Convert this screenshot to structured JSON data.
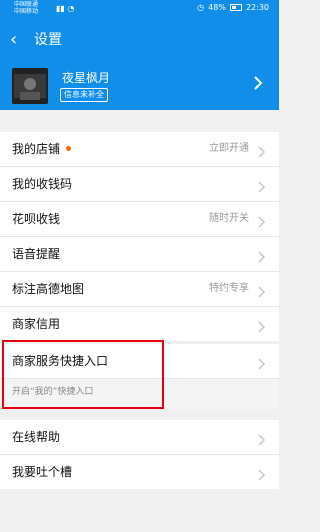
{
  "status_bar": {
    "carrier_1": "中国联通",
    "carrier_2": "中国移动",
    "battery": "48%",
    "time": "22:30"
  },
  "nav": {
    "title": "设置"
  },
  "profile": {
    "name": "夜星枫月",
    "badge": "信息未补全"
  },
  "groups": [
    {
      "items": [
        {
          "label": "我的店铺",
          "value": "立即开通",
          "has_dot": true
        },
        {
          "label": "我的收钱码",
          "value": ""
        },
        {
          "label": "花呗收钱",
          "value": "随时开关"
        },
        {
          "label": "语音提醒",
          "value": ""
        },
        {
          "label": "标注高德地图",
          "value": "特约专享"
        },
        {
          "label": "商家信用",
          "value": ""
        }
      ]
    },
    {
      "items": [
        {
          "label": "商家服务快捷入口",
          "value": ""
        }
      ],
      "hint": "开启“我的”快捷入口"
    },
    {
      "items": [
        {
          "label": "在线帮助",
          "value": ""
        },
        {
          "label": "我要吐个槽",
          "value": ""
        }
      ]
    }
  ],
  "colors": {
    "brand_blue": "#108ee9",
    "background": "#f0f0f0",
    "dot_orange": "#f56a00",
    "highlight_red": "#e60012"
  }
}
